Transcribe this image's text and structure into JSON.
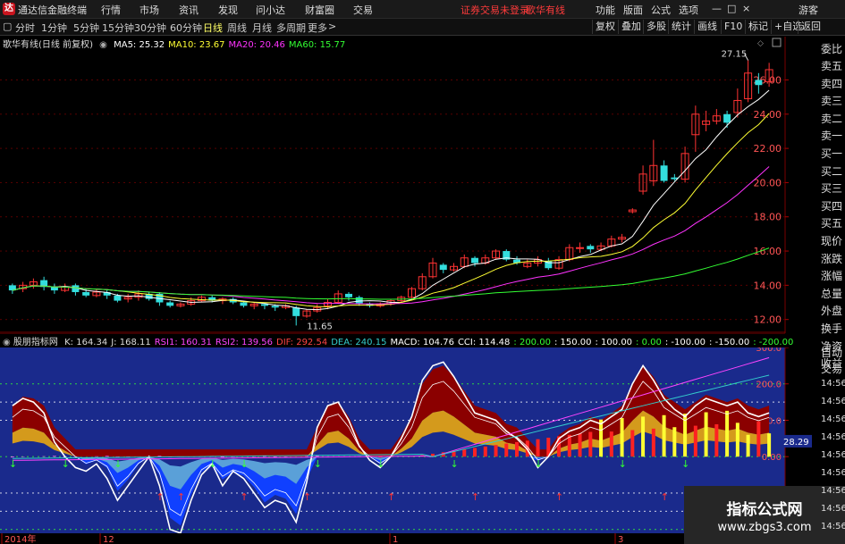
{
  "app": {
    "name": "通达信金融终端",
    "menu": [
      "行情",
      "市场",
      "资讯",
      "发现",
      "问小达",
      "财富圈",
      "交易"
    ],
    "status": [
      "证券交易未登录",
      "歌华有线"
    ],
    "right_menu": [
      "功能",
      "版面",
      "公式",
      "选项"
    ],
    "guest": "游客"
  },
  "toolbar": {
    "periods": [
      "分时",
      "1分钟",
      "5分钟",
      "15分钟",
      "30分钟",
      "60分钟",
      "日线",
      "周线",
      "月线",
      "多周期",
      "更多"
    ],
    "active_period": "日线",
    "right_buttons": [
      "复权",
      "叠加",
      "多股",
      "统计",
      "画线",
      "F10",
      "标记",
      "+自选",
      "返回"
    ]
  },
  "main": {
    "title": "歌华有线(日线 前复权)",
    "ma": [
      {
        "label": "MA5: 25.32",
        "color": "#ffffff"
      },
      {
        "label": "MA10: 23.67",
        "color": "#ffff33"
      },
      {
        "label": "MA20: 20.46",
        "color": "#ff33ff"
      },
      {
        "label": "MA60: 15.77",
        "color": "#33ff33"
      }
    ],
    "price_labels": [
      "26.00",
      "24.00",
      "22.00",
      "20.00",
      "18.00",
      "16.00",
      "14.00",
      "12.00"
    ],
    "high_label": "27.15",
    "low_label": "11.65"
  },
  "indicator": {
    "name": "股朋指标网",
    "values": [
      {
        "t": "K: 164.34",
        "c": "#dddddd"
      },
      {
        "t": "J: 168.11",
        "c": "#dddddd"
      },
      {
        "t": "RSI1: 160.31",
        "c": "#ff44ff"
      },
      {
        "t": "RSI2: 139.56",
        "c": "#ff44ff"
      },
      {
        "t": "DIF: 292.54",
        "c": "#ff4444"
      },
      {
        "t": "DEA: 240.15",
        "c": "#33cccc"
      },
      {
        "t": "MACD: 104.76",
        "c": "#ffffff"
      },
      {
        "t": "CCI: 114.48",
        "c": "#ffffff"
      },
      {
        "t": ": 200.00",
        "c": "#33ff33"
      },
      {
        "t": ": 150.00",
        "c": "#ffffff"
      },
      {
        "t": ": 100.00",
        "c": "#ffffff"
      },
      {
        "t": ": 0.00",
        "c": "#33ff33"
      },
      {
        "t": ": -100.00",
        "c": "#ffffff"
      },
      {
        "t": ": -150.00",
        "c": "#ffffff"
      },
      {
        "t": ": -200.00",
        "c": "#33ff33"
      }
    ],
    "axis_labels": [
      "300.0",
      "200.0",
      "100.0",
      "0.00"
    ],
    "current_value": "28.29"
  },
  "date_axis": [
    "2014年",
    "12",
    "1",
    "3"
  ],
  "side_panel": {
    "label": "委比",
    "rows": [
      "卖五",
      "卖四",
      "卖三",
      "卖二",
      "卖一",
      "买一",
      "买二",
      "买三",
      "买四",
      "买五",
      "现价",
      "涨跌",
      "涨幅",
      "总量",
      "外盘",
      "换手",
      "净资",
      "收益",
      "自动",
      "交易"
    ],
    "times": [
      "14:56",
      "14:56",
      "14:56",
      "14:56",
      "14:56",
      "14:56",
      "14:56",
      "14:56",
      "14:56"
    ]
  },
  "watermark": {
    "title": "指标公式网",
    "url": "www.zbgs3.com"
  },
  "chart_data": [
    {
      "type": "candlestick",
      "title": "歌华有线(日线 前复权)",
      "y_ticks": [
        12,
        14,
        16,
        18,
        20,
        22,
        24,
        26
      ],
      "ylim": [
        11.2,
        27.8
      ],
      "candles": [
        [
          14.0,
          13.7,
          14.1,
          13.5
        ],
        [
          13.8,
          14.0,
          14.2,
          13.6
        ],
        [
          14.0,
          14.2,
          14.4,
          13.8
        ],
        [
          14.3,
          13.9,
          14.5,
          13.7
        ],
        [
          13.9,
          13.7,
          14.1,
          13.5
        ],
        [
          13.7,
          13.9,
          14.1,
          13.6
        ],
        [
          14.0,
          13.6,
          14.1,
          13.4
        ],
        [
          13.6,
          13.4,
          13.8,
          13.3
        ],
        [
          13.4,
          13.6,
          13.8,
          13.3
        ],
        [
          13.6,
          13.4,
          13.7,
          13.2
        ],
        [
          13.4,
          13.1,
          13.5,
          13.0
        ],
        [
          13.2,
          13.3,
          13.5,
          13.0
        ],
        [
          13.3,
          13.5,
          13.7,
          13.1
        ],
        [
          13.5,
          13.2,
          13.6,
          13.1
        ],
        [
          13.5,
          13.0,
          13.6,
          12.8
        ],
        [
          13.0,
          12.8,
          13.1,
          12.7
        ],
        [
          12.8,
          12.9,
          13.0,
          12.7
        ],
        [
          12.9,
          13.1,
          13.3,
          12.8
        ],
        [
          13.1,
          13.3,
          13.4,
          13.0
        ],
        [
          13.3,
          13.1,
          13.4,
          13.0
        ],
        [
          13.1,
          13.2,
          13.3,
          12.9
        ],
        [
          13.2,
          13.0,
          13.3,
          12.9
        ],
        [
          13.0,
          12.8,
          13.1,
          12.7
        ],
        [
          12.8,
          12.9,
          13.0,
          12.6
        ],
        [
          12.9,
          12.8,
          13.0,
          12.6
        ],
        [
          12.8,
          12.7,
          12.9,
          12.5
        ],
        [
          12.7,
          12.8,
          12.9,
          12.6
        ],
        [
          12.7,
          12.2,
          12.8,
          11.65
        ],
        [
          12.2,
          12.5,
          12.6,
          12.1
        ],
        [
          12.5,
          12.7,
          12.9,
          12.4
        ],
        [
          12.8,
          13.0,
          13.2,
          12.6
        ],
        [
          13.0,
          13.5,
          13.7,
          12.9
        ],
        [
          13.5,
          13.3,
          13.6,
          13.1
        ],
        [
          13.3,
          12.9,
          13.4,
          12.8
        ],
        [
          12.9,
          12.8,
          13.0,
          12.7
        ],
        [
          12.8,
          12.9,
          13.0,
          12.7
        ],
        [
          12.9,
          13.1,
          13.2,
          12.8
        ],
        [
          13.1,
          13.3,
          13.4,
          13.0
        ],
        [
          13.3,
          13.8,
          13.9,
          13.2
        ],
        [
          13.8,
          14.5,
          14.7,
          13.7
        ],
        [
          14.5,
          15.3,
          15.6,
          14.4
        ],
        [
          15.2,
          14.9,
          15.3,
          14.7
        ],
        [
          14.9,
          15.1,
          15.3,
          14.8
        ],
        [
          15.1,
          15.6,
          15.8,
          15.0
        ],
        [
          15.6,
          15.3,
          15.7,
          15.1
        ],
        [
          15.3,
          15.6,
          15.8,
          15.2
        ],
        [
          15.6,
          16.0,
          16.1,
          15.5
        ],
        [
          16.0,
          15.5,
          16.1,
          15.4
        ],
        [
          15.5,
          15.3,
          15.7,
          15.2
        ],
        [
          15.1,
          15.3,
          15.5,
          15.0
        ],
        [
          15.3,
          15.5,
          15.7,
          15.1
        ],
        [
          15.4,
          15.0,
          15.6,
          14.9
        ],
        [
          15.0,
          15.5,
          15.7,
          14.9
        ],
        [
          15.5,
          16.2,
          16.4,
          15.4
        ],
        [
          16.2,
          16.2,
          16.5,
          15.9
        ],
        [
          16.3,
          16.1,
          16.4,
          15.9
        ],
        [
          16.1,
          16.3,
          16.5,
          16.0
        ],
        [
          16.3,
          16.7,
          16.9,
          16.2
        ],
        [
          16.7,
          16.8,
          17.0,
          16.5
        ],
        [
          18.3,
          18.4,
          18.5,
          18.2
        ],
        [
          19.5,
          20.5,
          21.0,
          19.3
        ],
        [
          20.1,
          21.0,
          22.5,
          19.8
        ],
        [
          21.0,
          20.1,
          21.3,
          20.0
        ],
        [
          20.3,
          20.2,
          20.5,
          20.1
        ],
        [
          20.2,
          21.7,
          22.1,
          20.0
        ],
        [
          22.8,
          24.0,
          24.5,
          21.8
        ],
        [
          23.4,
          23.6,
          24.2,
          23.0
        ],
        [
          23.6,
          23.9,
          24.3,
          23.4
        ],
        [
          24.0,
          23.5,
          24.2,
          23.2
        ],
        [
          24.1,
          24.8,
          25.5,
          23.8
        ],
        [
          24.9,
          26.4,
          27.15,
          24.7
        ],
        [
          26.0,
          25.7,
          26.4,
          25.2
        ],
        [
          25.9,
          26.6,
          27.0,
          25.6
        ]
      ]
    },
    {
      "type": "line",
      "title": "股朋指标网",
      "y_ticks": [
        0,
        100,
        200,
        300
      ],
      "ylim": [
        -240,
        300
      ],
      "series": [
        {
          "name": "K",
          "values": [
            120,
            145,
            140,
            120,
            60,
            30,
            0,
            -20,
            -10,
            -30,
            -90,
            -60,
            -20,
            0,
            -50,
            -160,
            -180,
            -100,
            -40,
            -20,
            -60,
            -40,
            -50,
            -80,
            -120,
            -100,
            -110,
            -150,
            -60,
            60,
            120,
            130,
            90,
            30,
            0,
            -20,
            0,
            40,
            90,
            180,
            220,
            230,
            200,
            160,
            120,
            110,
            100,
            70,
            60,
            30,
            -10,
            0,
            40,
            60,
            70,
            90,
            80,
            100,
            120,
            180,
            230,
            200,
            150,
            130,
            110,
            130,
            150,
            140,
            130,
            140,
            120,
            110,
            120
          ]
        },
        {
          "name": "J",
          "values": [
            140,
            160,
            150,
            120,
            40,
            0,
            -30,
            -40,
            -20,
            -60,
            -120,
            -80,
            -40,
            0,
            -80,
            -200,
            -210,
            -120,
            -50,
            -20,
            -80,
            -40,
            -60,
            -100,
            -140,
            -120,
            -130,
            -180,
            -70,
            80,
            140,
            150,
            100,
            30,
            -10,
            -30,
            0,
            50,
            110,
            210,
            250,
            260,
            220,
            170,
            120,
            110,
            100,
            70,
            50,
            20,
            -30,
            0,
            50,
            70,
            80,
            100,
            90,
            110,
            130,
            200,
            250,
            210,
            160,
            130,
            110,
            140,
            160,
            150,
            140,
            150,
            120,
            110,
            120
          ]
        }
      ]
    }
  ]
}
